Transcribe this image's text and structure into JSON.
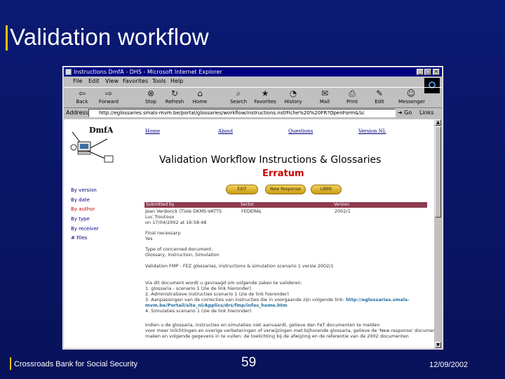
{
  "slide": {
    "title": "Validation workflow",
    "footer_left": "Crossroads Bank for Social Security",
    "page_number": "59",
    "date": "12/09/2002"
  },
  "window": {
    "title": "Instructions DmfA - DHS - Microsoft Internet Explorer",
    "buttons": [
      "_",
      "□",
      "×"
    ]
  },
  "menu": [
    "File",
    "Edit",
    "View",
    "Favorites",
    "Tools",
    "Help"
  ],
  "toolbar": {
    "back": "Back",
    "forward": "Forward",
    "stop": "Stop",
    "refresh": "Refresh",
    "home": "Home",
    "search": "Search",
    "favorites": "Favorites",
    "history": "History",
    "mail": "Mail",
    "print": "Print",
    "edit": "Edit",
    "messenger": "Messenger"
  },
  "address": {
    "label": "Address",
    "url": "http://eglossaries.smals-mvm.be/portal/glossaries/workflow/instructions.nsf/Fiche%20%20FR?OpenForm&Sc",
    "go": "Go",
    "links": "Links"
  },
  "page": {
    "logo": "DmfA",
    "nav": [
      "Home",
      "About",
      "Questions",
      "Version NL"
    ],
    "heading": "Validation Workflow Instructions & Glossaries",
    "erratum": "Erratum",
    "pills": [
      "EXIT",
      "New Response",
      "LIBRE"
    ],
    "side_links": [
      "By version",
      "By date",
      "By author",
      "By type",
      "By receiver",
      "# Files"
    ],
    "table_head": [
      "Submitted by",
      "Sector",
      "Version"
    ],
    "submitter": "Jean Verdonck (Tiole DKMS-VATTS",
    "submitter_line2": "Luc Troutoux",
    "submitted_on": "on 17/04/2002 at 16:58:48",
    "sector": "FEDERAL",
    "version": "2002/1",
    "final_label": "Final necessary:",
    "final_value": "Yes",
    "doc_type_label": "Type of concerned document:",
    "doc_type_value": "Glossary, Instruction, Simulation",
    "title_line": "Validation FMP - FEZ glossaries, instructions & simulation scenario 1 versie 2002/1",
    "body_lines": [
      "Via dit document wordt u gevraagd om volgende zaken te valideren:",
      "1. glossaria - scenario 1 (zie de link hieronder)",
      "2. Administratieve instructies scenario 1 (zie de link hieronder)",
      "3. Aanpassingen van de correcties van instructies die in voorgaande zijn volgende link: ",
      "mvm.be/Portail/site_nl/Applics/drs/fmp/infos_home.htm",
      "4. Simulaties scenario 1 (zie de link hieronder)"
    ],
    "link_text": "http://eglossaries.smals-",
    "bottom_lines": [
      "Indien u de glossaria, instructies en simulaties niet aanvaardt, gelieve dan FeT documenten te melden",
      "voor meer inlichtingen en overige verbeteringen of verwijzingen met bijhorende glossaria, gelieve de 'New response' document aan te",
      "maken en volgende gegevens in te vullen: de toelichting bij de afwijzing en de referentie van de 2002 documenten"
    ]
  },
  "colors": {
    "slide_bg": "#0b1a73",
    "accent_bar": "#e8c400",
    "erratum": "#cc0000",
    "table_head": "#8e3b4e",
    "titlebar": "#000080"
  }
}
